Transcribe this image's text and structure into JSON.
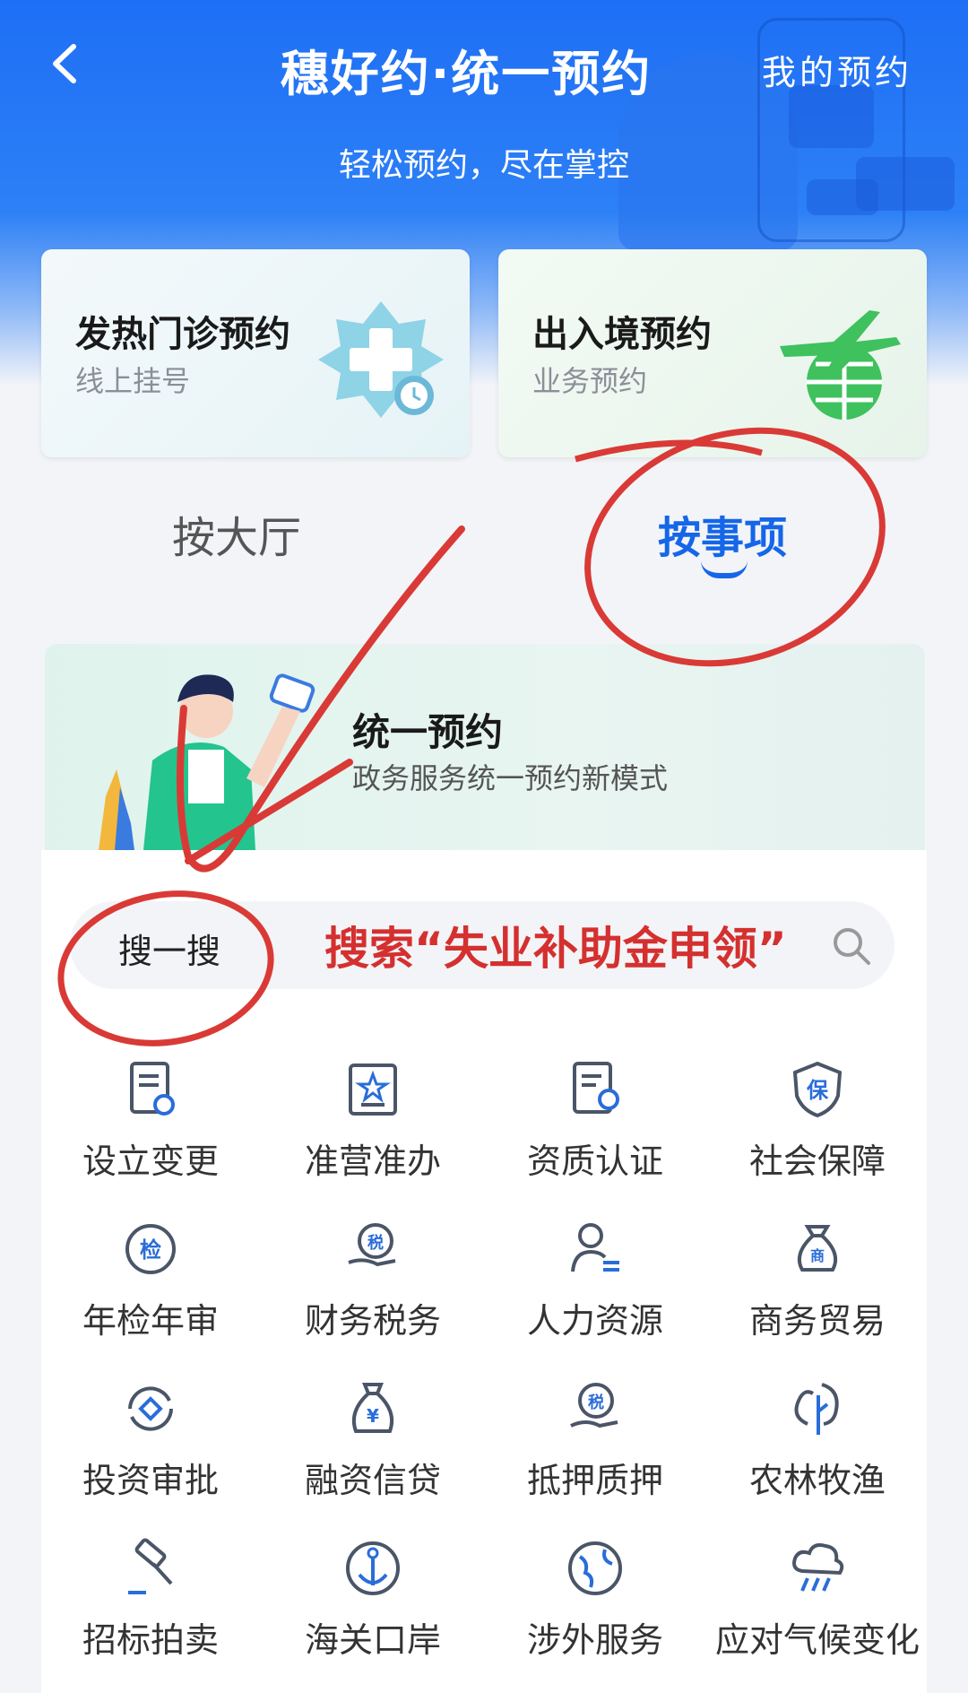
{
  "header": {
    "title": "穗好约·统一预约",
    "subtitle": "轻松预约，尽在掌控",
    "my_appointments": "我的预约"
  },
  "quick_cards": [
    {
      "title": "发热门诊预约",
      "subtitle": "线上挂号",
      "icon": "medical-cross-clock-icon"
    },
    {
      "title": "出入境预约",
      "subtitle": "业务预约",
      "icon": "plane-globe-icon"
    }
  ],
  "tabs": [
    {
      "label": "按大厅",
      "active": false
    },
    {
      "label": "按事项",
      "active": true
    }
  ],
  "banner": {
    "title": "统一预约",
    "subtitle": "政务服务统一预约新模式"
  },
  "search": {
    "label": "搜一搜",
    "placeholder": "搜索“失业补助金申领”"
  },
  "categories": [
    {
      "label": "设立变更",
      "icon": "document-refresh-icon"
    },
    {
      "label": "准营准办",
      "icon": "star-certificate-icon"
    },
    {
      "label": "资质认证",
      "icon": "certificate-badge-icon"
    },
    {
      "label": "社会保障",
      "icon": "shield-bao-icon"
    },
    {
      "label": "年检年审",
      "icon": "inspection-icon"
    },
    {
      "label": "财务税务",
      "icon": "tax-hand-icon"
    },
    {
      "label": "人力资源",
      "icon": "person-list-icon"
    },
    {
      "label": "商务贸易",
      "icon": "commerce-bag-icon"
    },
    {
      "label": "投资审批",
      "icon": "investment-cycle-icon"
    },
    {
      "label": "融资信贷",
      "icon": "money-bag-icon"
    },
    {
      "label": "抵押质押",
      "icon": "tax-mortgage-icon"
    },
    {
      "label": "农林牧渔",
      "icon": "tree-icon"
    },
    {
      "label": "招标拍卖",
      "icon": "gavel-icon"
    },
    {
      "label": "海关口岸",
      "icon": "anchor-icon"
    },
    {
      "label": "涉外服务",
      "icon": "globe-icon"
    },
    {
      "label": "应对气候变化",
      "icon": "cloud-rain-icon"
    }
  ],
  "colors": {
    "header_blue": "#1e6ff5",
    "active_tab": "#1566e8",
    "annotation_red": "#d4302f",
    "icon_blue": "#2a6dd9"
  }
}
